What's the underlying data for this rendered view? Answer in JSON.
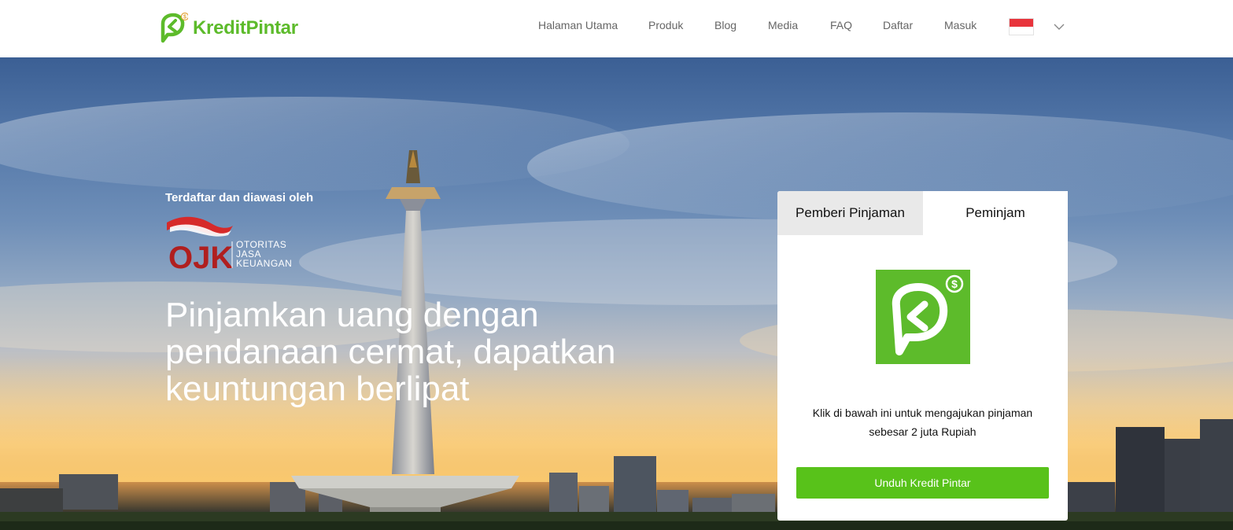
{
  "brand": {
    "name": "KreditPintar",
    "color": "#5dbb2b",
    "icon": "kredit-pintar-logo-icon"
  },
  "nav": {
    "items": [
      {
        "label": "Halaman Utama"
      },
      {
        "label": "Produk"
      },
      {
        "label": "Blog"
      },
      {
        "label": "Media"
      },
      {
        "label": "FAQ"
      },
      {
        "label": "Daftar"
      },
      {
        "label": "Masuk"
      }
    ],
    "language_flag": "indonesia-flag-icon",
    "language_dropdown": "chevron-down-icon"
  },
  "hero": {
    "supervised_label": "Terdaftar dan diawasi oleh",
    "regulator_logo": {
      "mark": "OJK",
      "lines": [
        "OTORITAS",
        "JASA",
        "KEUANGAN"
      ]
    },
    "headline": "Pinjamkan uang dengan pendanaan cermat, dapatkan keuntungan berlipat"
  },
  "card": {
    "tabs": [
      {
        "label": "Pemberi Pinjaman",
        "active": false
      },
      {
        "label": "Peminjam",
        "active": true
      }
    ],
    "app_icon": "kredit-pintar-app-icon",
    "description_line1": "Klik di bawah ini untuk mengajukan pinjaman",
    "description_line2": "sebesar 2 juta Rupiah",
    "button_label": "Unduh Kredit Pintar",
    "button_color": "#58c21a"
  }
}
